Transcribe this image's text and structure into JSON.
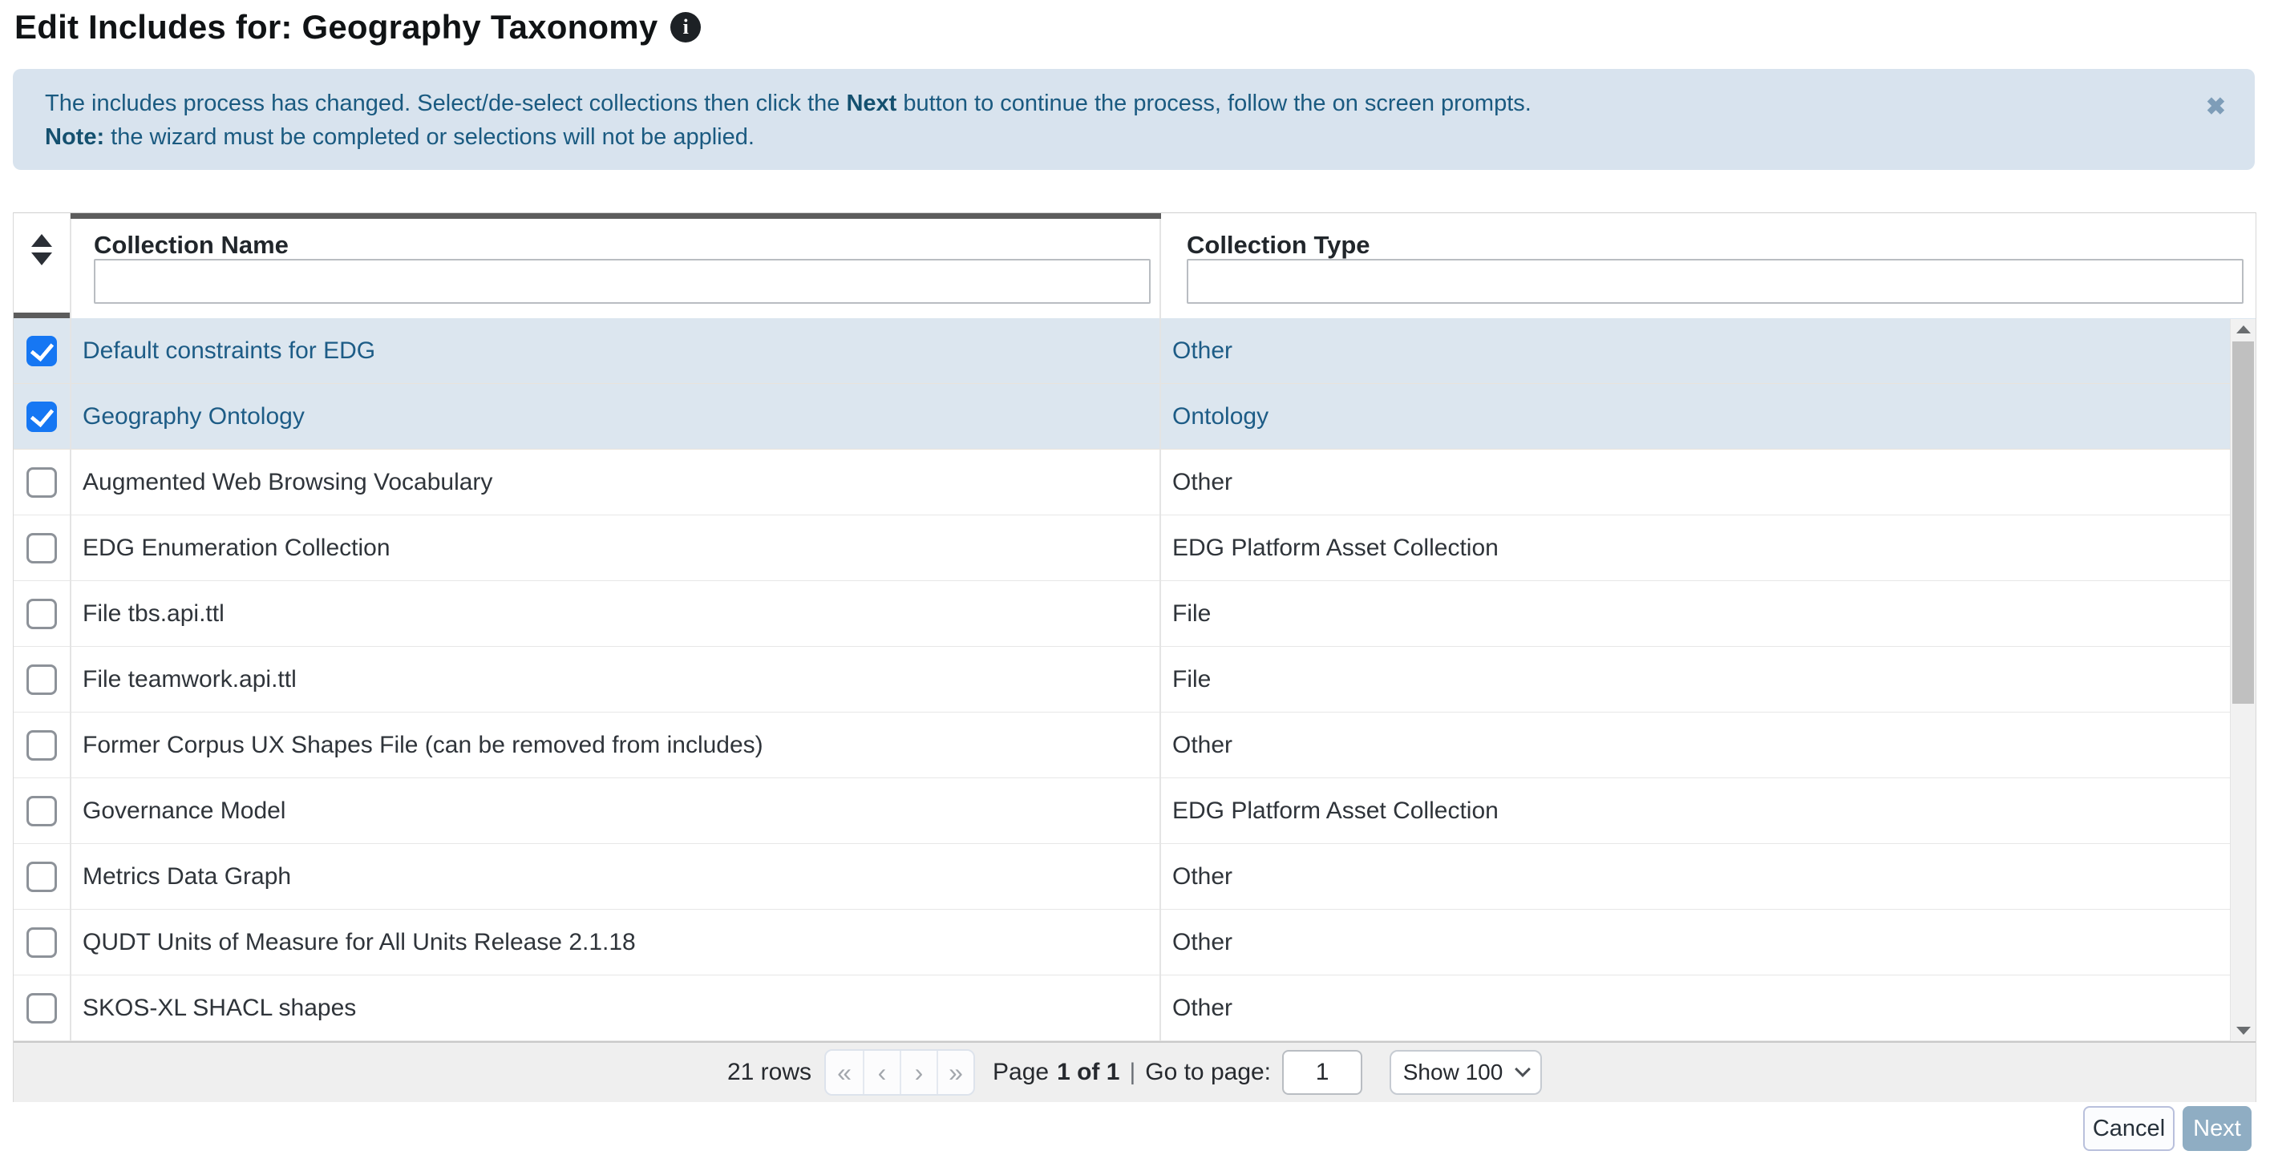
{
  "title": "Edit Includes for: Geography Taxonomy",
  "title_info_glyph": "i",
  "banner": {
    "line1_pre": "The includes process has changed. Select/de-select collections then click the ",
    "line1_bold": "Next",
    "line1_post": " button to continue the process, follow the on screen prompts.",
    "line2_bold": "Note:",
    "line2_post": " the wizard must be completed or selections will not be applied.",
    "close_glyph": "✖"
  },
  "table": {
    "columns": [
      {
        "label": "Collection Name"
      },
      {
        "label": "Collection Type"
      }
    ],
    "filters": {
      "name_value": "",
      "type_value": ""
    },
    "rows": [
      {
        "name": "Default constraints for EDG",
        "type": "Other",
        "checked": true
      },
      {
        "name": "Geography Ontology",
        "type": "Ontology",
        "checked": true
      },
      {
        "name": "Augmented Web Browsing Vocabulary",
        "type": "Other",
        "checked": false
      },
      {
        "name": "EDG Enumeration Collection",
        "type": "EDG Platform Asset Collection",
        "checked": false
      },
      {
        "name": "File tbs.api.ttl",
        "type": "File",
        "checked": false
      },
      {
        "name": "File teamwork.api.ttl",
        "type": "File",
        "checked": false
      },
      {
        "name": "Former Corpus UX Shapes File (can be removed from includes)",
        "type": "Other",
        "checked": false
      },
      {
        "name": "Governance Model",
        "type": "EDG Platform Asset Collection",
        "checked": false
      },
      {
        "name": "Metrics Data Graph",
        "type": "Other",
        "checked": false
      },
      {
        "name": "QUDT Units of Measure for All Units Release 2.1.18",
        "type": "Other",
        "checked": false
      },
      {
        "name": "SKOS-XL SHACL shapes",
        "type": "Other",
        "checked": false
      }
    ]
  },
  "pagination": {
    "rows_text": "21 rows",
    "buttons": [
      {
        "glyph": "«",
        "name": "first-page-button"
      },
      {
        "glyph": "‹",
        "name": "previous-page-button"
      },
      {
        "glyph": "›",
        "name": "next-page-button"
      },
      {
        "glyph": "»",
        "name": "last-page-button"
      }
    ],
    "page_label": "Page",
    "page_value": "1 of 1",
    "separator": "|",
    "goto_label": "Go to page:",
    "goto_value": "1",
    "page_size_value": "Show 100"
  },
  "actions": {
    "cancel": "Cancel",
    "next": "Next"
  },
  "colors": {
    "accent_checkbox_blue": "#1677f3",
    "selected_row_bg": "#dce6ef",
    "selected_row_text": "#1d5c86",
    "banner_bg": "#d8e3ee",
    "banner_text": "#1a5a80",
    "next_button_bg": "#8fadc3",
    "drag_bar_gray": "#5c5c5c"
  }
}
